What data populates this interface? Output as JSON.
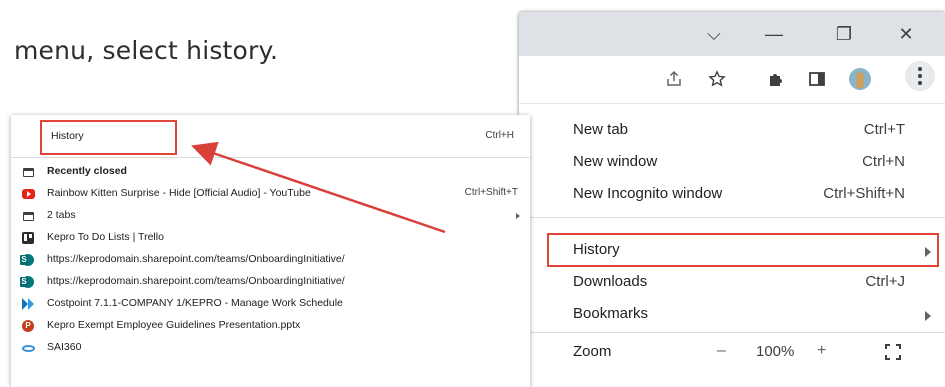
{
  "instruction": "menu, select history.",
  "window_controls": {
    "tabsearch": "⌵",
    "minimize": "—",
    "restore": "❐",
    "close": "✕"
  },
  "toolbar": {
    "icons": [
      "share-icon",
      "bookmark-star-icon",
      "extensions-puzzle-icon",
      "side-panel-icon",
      "profile-avatar",
      "more-menu-icon"
    ]
  },
  "chrome_menu": {
    "items": [
      {
        "label": "New tab",
        "shortcut": "Ctrl+T"
      },
      {
        "label": "New window",
        "shortcut": "Ctrl+N"
      },
      {
        "label": "New Incognito window",
        "shortcut": "Ctrl+Shift+N"
      },
      {
        "label": "History",
        "shortcut": "",
        "submenu": true
      },
      {
        "label": "Downloads",
        "shortcut": "Ctrl+J"
      },
      {
        "label": "Bookmarks",
        "shortcut": "",
        "submenu": true
      }
    ],
    "zoom": {
      "label": "Zoom",
      "minus": "–",
      "value": "100%",
      "plus": "+"
    }
  },
  "history_menu": {
    "header": {
      "label": "History",
      "shortcut": "Ctrl+H"
    },
    "recently_closed": "Recently closed",
    "entries": [
      {
        "icon": "youtube-icon",
        "title": "Rainbow Kitten Surprise - Hide [Official Audio] - YouTube",
        "shortcut": "Ctrl+Shift+T"
      },
      {
        "icon": "tabs-icon",
        "title": "2 tabs",
        "shortcut": ""
      },
      {
        "icon": "trello-icon",
        "title": "Kepro To Do Lists | Trello",
        "shortcut": ""
      },
      {
        "icon": "sharepoint-icon",
        "title": "https://keprodomain.sharepoint.com/teams/OnboardingInitiative/",
        "shortcut": ""
      },
      {
        "icon": "sharepoint-icon",
        "title": "https://keprodomain.sharepoint.com/teams/OnboardingInitiative/",
        "shortcut": ""
      },
      {
        "icon": "costpoint-icon",
        "title": "Costpoint 7.1.1-COMPANY 1/KEPRO - Manage Work Schedule",
        "shortcut": ""
      },
      {
        "icon": "powerpoint-icon",
        "title": "Kepro Exempt Employee Guidelines Presentation.pptx",
        "shortcut": ""
      },
      {
        "icon": "sai360-icon",
        "title": "SAI360",
        "shortcut": ""
      }
    ]
  },
  "colors": {
    "highlight_box": "#e0453a",
    "arrow": "#d9403a",
    "titlebar": "#dee1e6"
  }
}
